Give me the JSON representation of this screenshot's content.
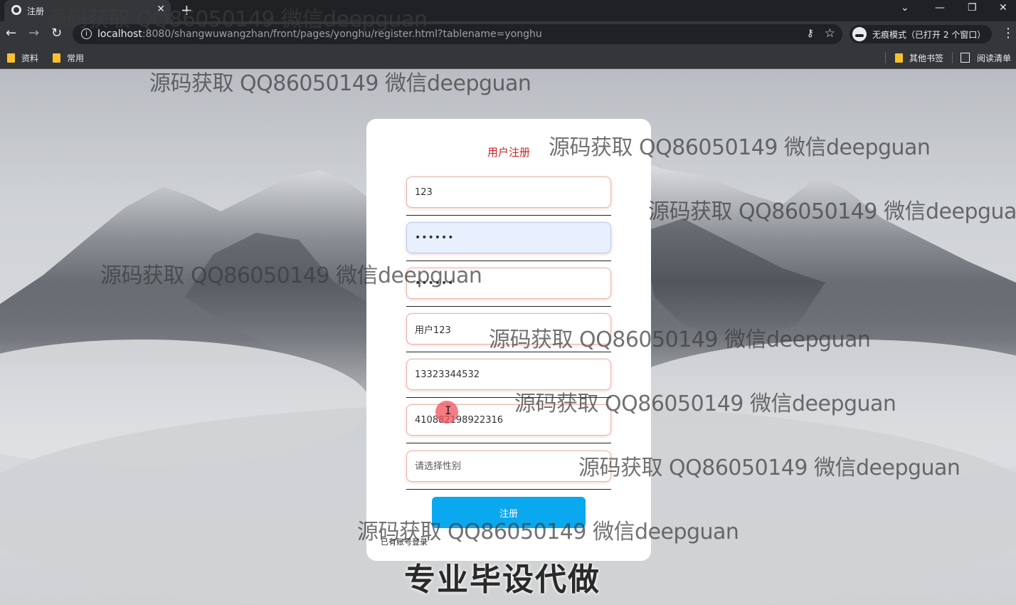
{
  "browser": {
    "tab_title": "注册",
    "url_host": "localhost",
    "url_rest": ":8080/shangwuwangzhan/front/pages/yonghu/register.html?tablename=yonghu",
    "incognito_label": "无痕模式（已打开 2 个窗口）",
    "bookmarks": [
      "资料",
      "常用"
    ],
    "bookmarks_right": [
      "其他书签",
      "阅读清单"
    ]
  },
  "form": {
    "title": "用户注册",
    "username": "123",
    "password": "••••••",
    "confirm_password": "••••••",
    "name": "用户123",
    "phone": "13323344532",
    "id_card": "410882198922316",
    "gender_placeholder": "请选择性别",
    "submit_label": "注册",
    "login_link": "已有账号登录"
  },
  "overlay": {
    "watermark_text": "源码获取 QQ86050149 微信deepguan",
    "bottom_text": "专业毕设代做"
  },
  "colors": {
    "title_red": "#cc2222",
    "button_blue": "#0aa8ee",
    "chrome_dark": "#202124"
  }
}
